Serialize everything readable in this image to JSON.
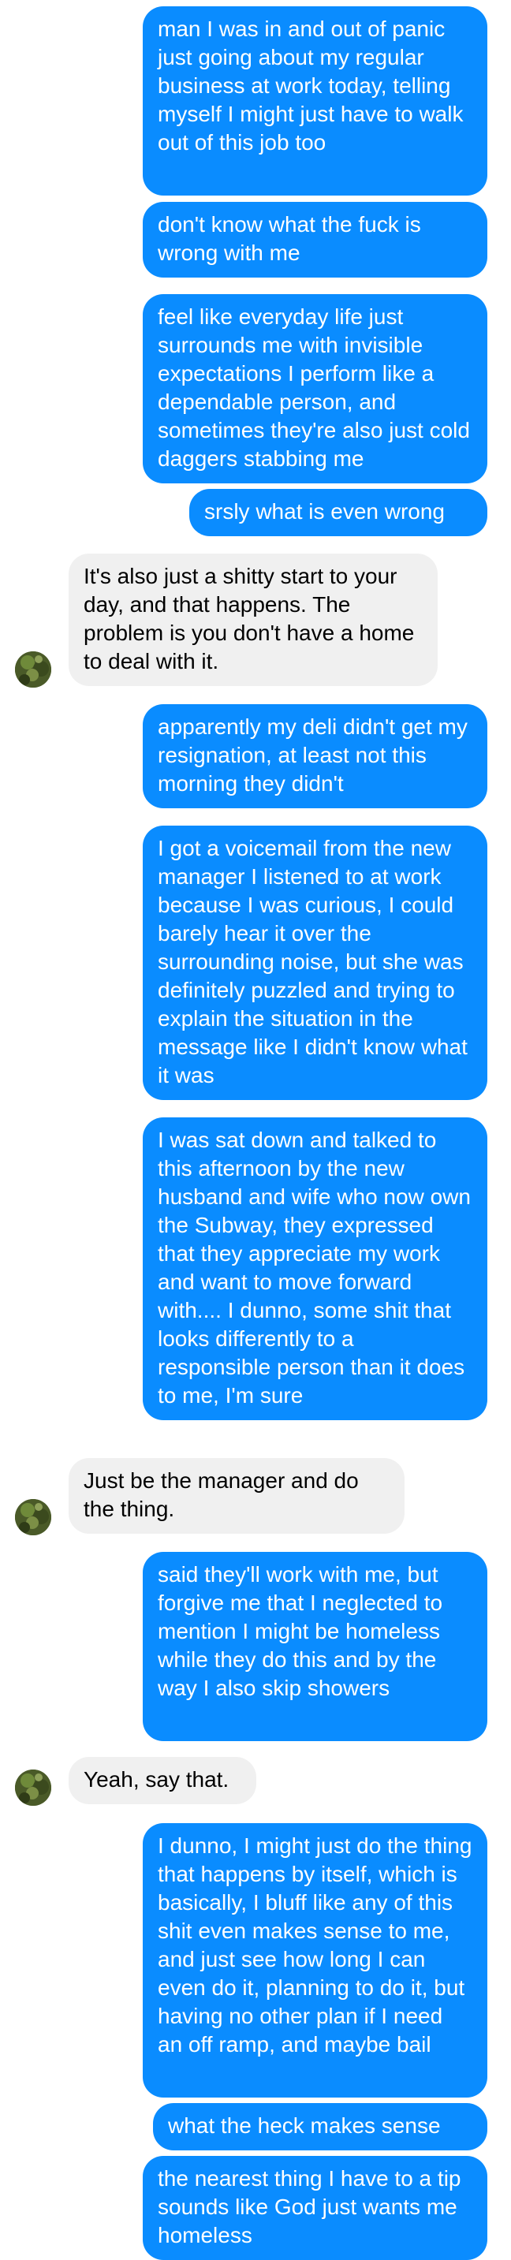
{
  "thread": {
    "colors": {
      "outgoing_bubble": "#0a8cff",
      "outgoing_text": "#ffffff",
      "incoming_bubble": "#f0f0f0",
      "incoming_text": "#000000"
    },
    "avatar_icon": "contact-avatar-photo",
    "messages": [
      {
        "sender": "me",
        "text": "man I was in and out of panic just going about my regular business at work today, telling myself I might just have to walk out of this job too"
      },
      {
        "sender": "me",
        "text": "don't know what the fuck is wrong with me"
      },
      {
        "sender": "me",
        "text": "feel like everyday life just surrounds me with invisible expectations I perform like a dependable person, and sometimes they're also just cold daggers stabbing me"
      },
      {
        "sender": "me",
        "text": "srsly what is even wrong"
      },
      {
        "sender": "them",
        "text": "It's also just a shitty start to your day, and that happens. The problem is you don't have a home to deal with it."
      },
      {
        "sender": "me",
        "text": "apparently my deli didn't get my resignation, at least not this morning they didn't"
      },
      {
        "sender": "me",
        "text": "I got a voicemail from the new manager I listened to at work because I was curious, I could barely hear it over the surrounding noise, but she was definitely puzzled and trying to explain the situation in the message like I didn't know what it was"
      },
      {
        "sender": "me",
        "text": "I was sat down and talked to this afternoon by the new husband and wife who now own the Subway, they expressed that they appreciate my work and want to move forward with.... I dunno, some shit that looks differently to a responsible person than it does to me, I'm sure"
      },
      {
        "sender": "them",
        "text": "Just be the manager and do the thing."
      },
      {
        "sender": "me",
        "text": "said they'll work with me, but forgive me that I neglected to mention I might be homeless while they do this and by the way I also skip showers"
      },
      {
        "sender": "them",
        "text": "Yeah, say that."
      },
      {
        "sender": "me",
        "text": "I dunno, I might just do the thing that happens by itself, which is basically, I bluff like any of this shit even makes sense to me, and just see how long I can even do it, planning to do it, but having no other plan if I need an off ramp, and maybe bail"
      },
      {
        "sender": "me",
        "text": "what the heck makes sense"
      },
      {
        "sender": "me",
        "text": "the nearest thing I have to a tip sounds like God just wants me homeless"
      }
    ]
  }
}
